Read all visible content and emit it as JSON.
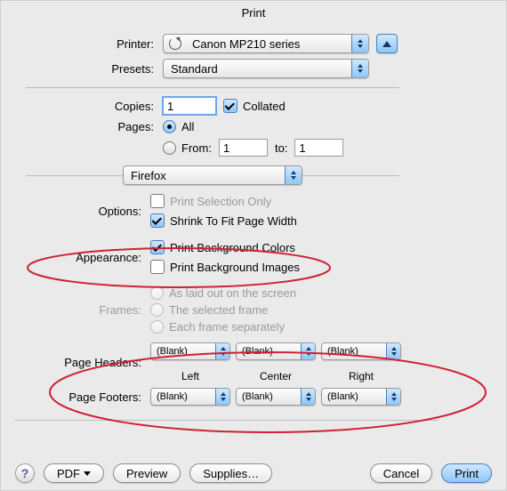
{
  "title": "Print",
  "printer": {
    "label": "Printer:",
    "value": "Canon MP210 series"
  },
  "presets": {
    "label": "Presets:",
    "value": "Standard"
  },
  "copies": {
    "label": "Copies:",
    "value": "1",
    "collated_label": "Collated",
    "collated": true
  },
  "pages": {
    "label": "Pages:",
    "all_label": "All",
    "from_label": "From:",
    "to_label": "to:",
    "from_value": "1",
    "to_value": "1",
    "mode": "all"
  },
  "app_popup": "Firefox",
  "options": {
    "label": "Options:",
    "print_selection_label": "Print Selection Only",
    "print_selection": false,
    "shrink_label": "Shrink To Fit Page Width",
    "shrink": true
  },
  "appearance": {
    "label": "Appearance:",
    "bg_colors_label": "Print Background Colors",
    "bg_colors": true,
    "bg_images_label": "Print Background Images",
    "bg_images": false
  },
  "frames": {
    "label": "Frames:",
    "as_laid_label": "As laid out on the screen",
    "selected_label": "The selected frame",
    "each_label": "Each frame separately"
  },
  "headers": {
    "label": "Page Headers:",
    "left": "(Blank)",
    "center": "(Blank)",
    "right": "(Blank)",
    "col_left": "Left",
    "col_center": "Center",
    "col_right": "Right"
  },
  "footers": {
    "label": "Page Footers:",
    "left": "(Blank)",
    "center": "(Blank)",
    "right": "(Blank)"
  },
  "buttons": {
    "help": "?",
    "pdf": "PDF",
    "preview": "Preview",
    "supplies": "Supplies…",
    "cancel": "Cancel",
    "print": "Print"
  },
  "annotation_color": "#d02030"
}
